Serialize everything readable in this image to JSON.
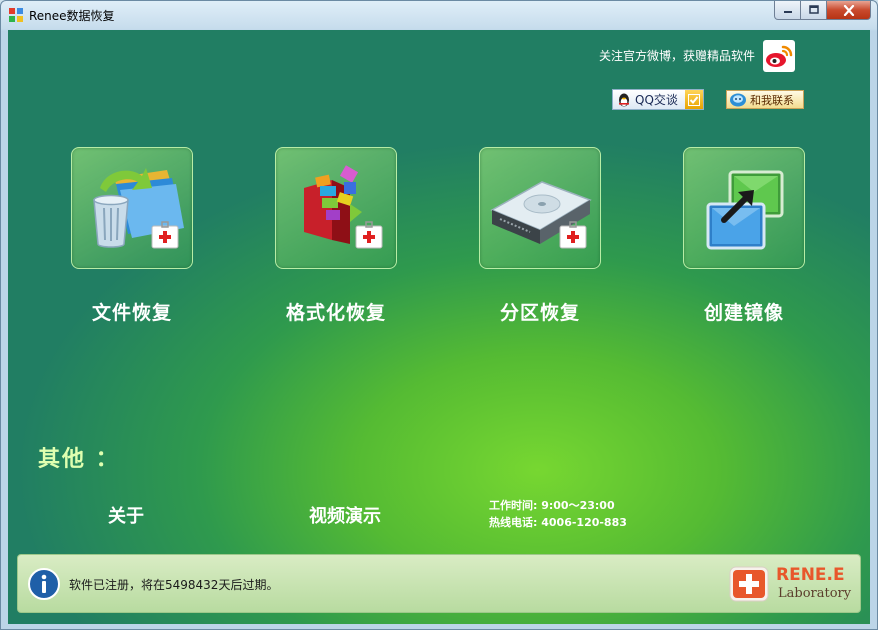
{
  "window": {
    "title": "Renee数据恢复"
  },
  "header": {
    "weibo_text": "关注官方微博，获赠精品软件",
    "qq_label": "QQ交谈",
    "contact_label": "和我联系"
  },
  "tiles": [
    {
      "label": "文件恢复",
      "icon": "file-recovery-icon"
    },
    {
      "label": "格式化恢复",
      "icon": "format-recovery-icon"
    },
    {
      "label": "分区恢复",
      "icon": "partition-recovery-icon"
    },
    {
      "label": "创建镜像",
      "icon": "create-image-icon"
    }
  ],
  "others": {
    "title": "其他 ：",
    "about": "关于",
    "video": "视频演示",
    "hours": "工作时间: 9:00～23:00",
    "phone": "热线电话: 4006-120-883"
  },
  "status": {
    "text": "软件已注册，将在5498432天后过期。"
  },
  "brand": {
    "name": "RENE.E",
    "sub": "Laboratory"
  },
  "colors": {
    "accent_green": "#55bb33",
    "dark_teal": "#217e63",
    "brand_orange": "#e8572b"
  }
}
